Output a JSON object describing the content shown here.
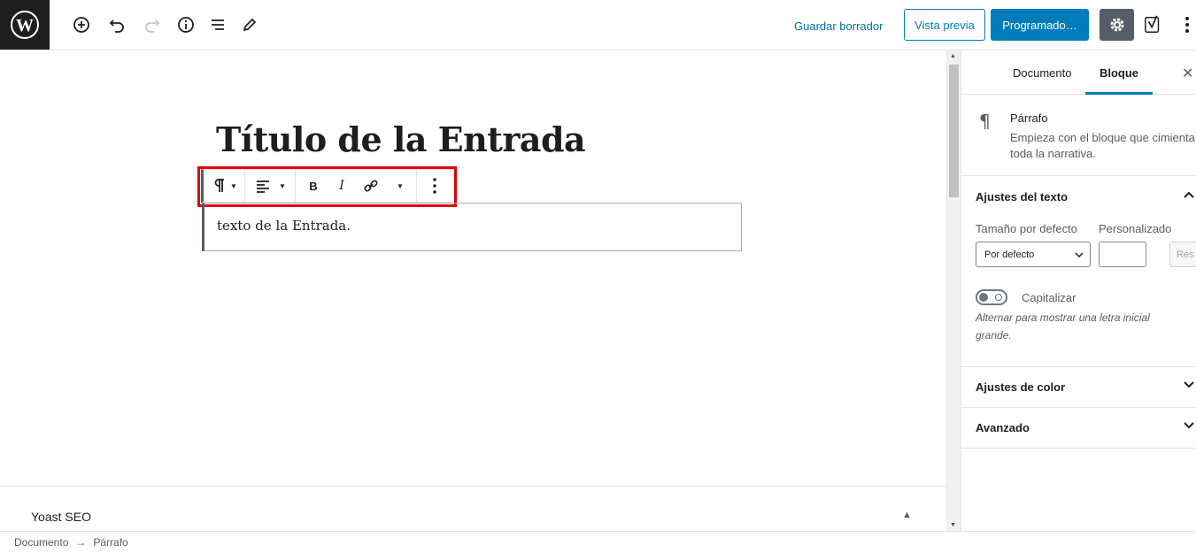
{
  "header": {
    "save_draft": "Guardar borrador",
    "preview": "Vista previa",
    "publish": "Programado…"
  },
  "icons": {
    "logo": "wordpress-logo-icon",
    "add": "add-block-icon",
    "undo": "undo-icon",
    "redo": "redo-icon",
    "info": "info-icon",
    "outline": "list-view-icon",
    "tools": "edit-pencil-icon",
    "settings": "gear-icon",
    "yoast": "yoast-icon",
    "more": "more-vertical-icon"
  },
  "colors": {
    "primary": "#007cba",
    "link": "#0073aa",
    "dark": "#1e1e1e",
    "highlight": "#e00000"
  },
  "editor": {
    "title": "Título de la Entrada",
    "paragraph": "texto de la Entrada.",
    "toolbar": {
      "bold": "B",
      "italic": "I"
    }
  },
  "meta_box": {
    "yoast_title": "Yoast SEO"
  },
  "sidebar": {
    "tabs": [
      "Documento",
      "Bloque"
    ],
    "active_tab": "Bloque",
    "block_card": {
      "title": "Párrafo",
      "description": "Empieza con el bloque que cimienta toda la narrativa."
    },
    "text_settings": {
      "title": "Ajustes del texto",
      "size_label": "Tamaño por defecto",
      "custom_label": "Personalizado",
      "size_value": "Por defecto",
      "reset_label": "Res",
      "dropcap_label": "Capitalizar",
      "dropcap_help": "Alternar para mostrar una letra inicial grande."
    },
    "color_settings": {
      "title": "Ajustes de color"
    },
    "advanced": {
      "title": "Avanzado"
    }
  },
  "footer": {
    "breadcrumb": [
      "Documento",
      "Párrafo"
    ],
    "separator": "→"
  }
}
